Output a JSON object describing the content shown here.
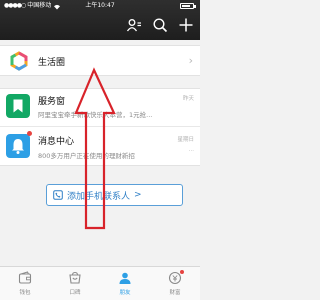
{
  "status_bar": {
    "carrier": "中国移动",
    "time": "上午10:47"
  },
  "colors": {
    "top_bar": "#2b2b2b",
    "service_icon": "#12a864",
    "message_icon": "#2d9fe5",
    "accent_blue": "#2d9fe5",
    "annotation_red": "#d8232a",
    "badge_red": "#e64340"
  },
  "header": {
    "icons": [
      "contacts-icon",
      "search-icon",
      "plus-icon"
    ]
  },
  "moments_row": {
    "icon": "moments-icon",
    "label": "生活圈"
  },
  "conversations": [
    {
      "icon": "bookmark-icon",
      "title": "服务窗",
      "subtitle": "阿里宝宝牵手新歌快乐大本营，1元抢...",
      "meta": "昨天",
      "badge": false
    },
    {
      "icon": "bell-icon",
      "title": "消息中心",
      "subtitle": "800多万用户正在使用的理财新招",
      "meta": "星期日",
      "meta2": "...",
      "badge": true
    }
  ],
  "add_contact": {
    "label": "添加手机联系人",
    "arrow": ">",
    "icon": "phone-icon"
  },
  "tabbar": {
    "tabs": [
      {
        "label": "钱包",
        "icon": "wallet-icon",
        "active": false
      },
      {
        "label": "口碑",
        "icon": "koubei-icon",
        "active": false
      },
      {
        "label": "朋友",
        "icon": "friends-icon",
        "active": true
      },
      {
        "label": "财富",
        "icon": "wealth-icon",
        "active": false,
        "badge": true
      }
    ]
  }
}
